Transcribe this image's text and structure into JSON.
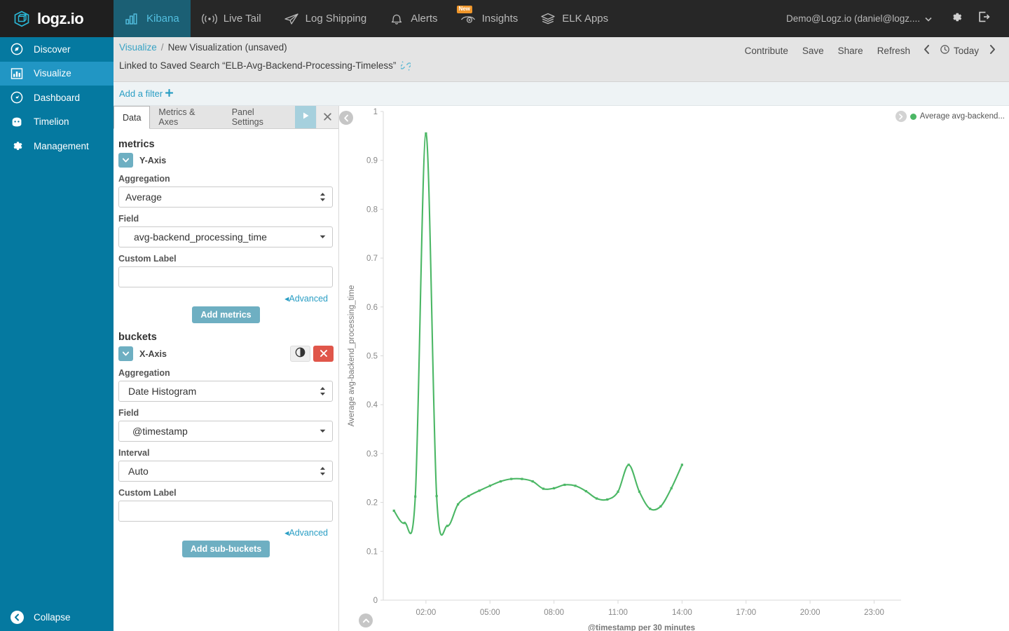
{
  "topnav": {
    "brand": "logz.io",
    "items": [
      {
        "label": "Kibana",
        "icon": "bar-chart-icon",
        "active": true,
        "badge": ""
      },
      {
        "label": "Live Tail",
        "icon": "broadcast-icon",
        "active": false,
        "badge": ""
      },
      {
        "label": "Log Shipping",
        "icon": "paper-plane-icon",
        "active": false,
        "badge": ""
      },
      {
        "label": "Alerts",
        "icon": "bell-icon",
        "active": false,
        "badge": ""
      },
      {
        "label": "Insights",
        "icon": "eye-icon",
        "active": false,
        "badge": "New"
      },
      {
        "label": "ELK Apps",
        "icon": "layers-icon",
        "active": false,
        "badge": ""
      }
    ],
    "user": "Demo@Logz.io (daniel@logz....",
    "settings_icon": "gear-icon",
    "logout_icon": "logout-icon"
  },
  "sidebar": {
    "items": [
      {
        "label": "Discover",
        "icon": "compass-icon",
        "active": false
      },
      {
        "label": "Visualize",
        "icon": "bar-chart-icon",
        "active": true
      },
      {
        "label": "Dashboard",
        "icon": "dashboard-icon",
        "active": false
      },
      {
        "label": "Timelion",
        "icon": "timelion-icon",
        "active": false
      },
      {
        "label": "Management",
        "icon": "gear-icon",
        "active": false
      }
    ],
    "collapse_label": "Collapse",
    "collapse_icon": "chevron-left-circle-icon"
  },
  "breadcrumb": {
    "root": "Visualize",
    "separator": "/",
    "current": "New Visualization (unsaved)",
    "linked_text": "Linked to Saved Search “ELB-Avg-Backend-Processing-Timeless”",
    "unlink_icon": "unlink-icon"
  },
  "toolbar": {
    "contribute_label": "Contribute",
    "save_label": "Save",
    "share_label": "Share",
    "refresh_label": "Refresh",
    "prev_icon": "chevron-left-icon",
    "clock_icon": "clock-icon",
    "time_range": "Today",
    "next_icon": "chevron-right-icon"
  },
  "filterbar": {
    "add_filter_label": "Add a filter",
    "add_icon": "plus-icon"
  },
  "editor": {
    "tabs": [
      {
        "label": "Data",
        "active": true
      },
      {
        "label": "Metrics & Axes",
        "active": false
      },
      {
        "label": "Panel Settings",
        "active": false
      }
    ],
    "apply_icon": "play-icon",
    "discard_icon": "close-icon",
    "metrics": {
      "section_label": "metrics",
      "axis_label": "Y-Axis",
      "collapse_icon": "caret-down-icon",
      "aggregation_label": "Aggregation",
      "aggregation_value": "Average",
      "field_label": "Field",
      "field_value": "avg-backend_processing_time",
      "custom_label_label": "Custom Label",
      "custom_label_value": "",
      "custom_label_placeholder": "",
      "advanced_label": "Advanced",
      "add_button": "Add metrics"
    },
    "buckets": {
      "section_label": "buckets",
      "axis_label": "X-Axis",
      "collapse_icon": "caret-down-icon",
      "toggle_icon": "circle-half-icon",
      "remove_icon": "close-icon",
      "aggregation_label": "Aggregation",
      "aggregation_value": "Date Histogram",
      "field_label": "Field",
      "field_value": "@timestamp",
      "interval_label": "Interval",
      "interval_value": "Auto",
      "custom_label_label": "Custom Label",
      "custom_label_value": "",
      "custom_label_placeholder": "",
      "advanced_label": "Advanced",
      "add_button": "Add sub-buckets"
    }
  },
  "visualization": {
    "collapse_left_icon": "chevron-left-circle-icon",
    "collapse_bottom_icon": "chevron-up-circle-icon",
    "legend_toggle_icon": "chevron-right-circle-icon",
    "legend_label": "Average avg-backend...",
    "legend_color": "#4bb765"
  },
  "chart_data": {
    "type": "line",
    "title": "",
    "xlabel": "@timestamp per 30 minutes",
    "ylabel": "Average avg-backend_processing_time",
    "ylim": [
      0,
      1
    ],
    "yticks": [
      0,
      0.1,
      0.2,
      0.3,
      0.4,
      0.5,
      0.6,
      0.7,
      0.8,
      0.9,
      1
    ],
    "xticks": [
      "02:00",
      "05:00",
      "08:00",
      "11:00",
      "14:00",
      "17:00",
      "20:00",
      "23:00"
    ],
    "xlim_hours": [
      0.5,
      24
    ],
    "grid": false,
    "legend_position": "top-right",
    "line_color": "#4bb765",
    "series": [
      {
        "name": "Average avg-backend_processing_time",
        "x": [
          "00:30",
          "01:00",
          "01:30",
          "02:00",
          "02:30",
          "03:00",
          "03:30",
          "04:00",
          "04:30",
          "05:00",
          "05:30",
          "06:00",
          "06:30",
          "07:00",
          "07:30",
          "08:00",
          "08:30",
          "09:00",
          "09:30",
          "10:00",
          "10:30",
          "11:00",
          "11:30",
          "12:00",
          "12:30",
          "13:00",
          "13:30",
          "14:00"
        ],
        "values": [
          0.183,
          0.158,
          0.212,
          0.955,
          0.213,
          0.152,
          0.196,
          0.213,
          0.224,
          0.234,
          0.243,
          0.248,
          0.248,
          0.243,
          0.228,
          0.229,
          0.236,
          0.234,
          0.223,
          0.208,
          0.206,
          0.222,
          0.277,
          0.222,
          0.187,
          0.192,
          0.229,
          0.277
        ]
      }
    ]
  }
}
